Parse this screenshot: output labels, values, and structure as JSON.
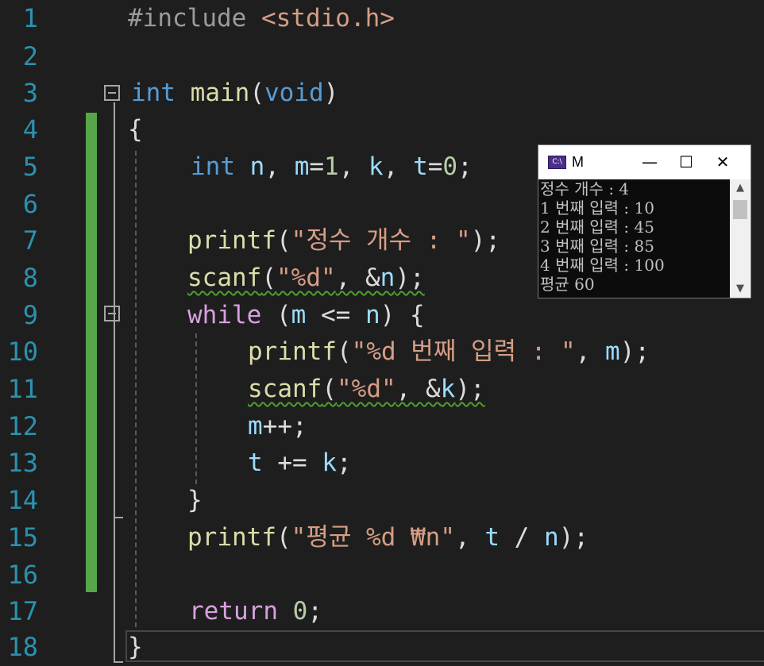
{
  "editor": {
    "line_numbers": [
      "1",
      "2",
      "3",
      "4",
      "5",
      "6",
      "7",
      "8",
      "9",
      "10",
      "11",
      "12",
      "13",
      "14",
      "15",
      "16",
      "17",
      "18"
    ],
    "lines": {
      "l1": {
        "pp": "#include",
        "header": "<stdio.h>"
      },
      "l3": {
        "kw_int": "int",
        "fn_main": "main",
        "paren_open": "(",
        "kw_void": "void",
        "paren_close": ")"
      },
      "l4": {
        "brace": "{"
      },
      "l5": {
        "kw_int": "int",
        "n": "n",
        "comma1": ",",
        "m": "m",
        "eq1": "=",
        "one": "1",
        "comma2": ",",
        "k": "k",
        "comma3": ",",
        "t": "t",
        "eq2": "=",
        "zero": "0",
        "semi": ";"
      },
      "l7": {
        "fn": "printf",
        "open": "(",
        "str": "\"정수 개수 : \"",
        "close": ");"
      },
      "l8": {
        "fn": "scanf",
        "open": "(",
        "str": "\"%d\"",
        "sep": ", &",
        "var": "n",
        "close": ");"
      },
      "l9": {
        "kw_while": "while",
        "open": " (",
        "m": "m",
        "op": " <= ",
        "n": "n",
        "close": ") {"
      },
      "l10": {
        "fn": "printf",
        "open": "(",
        "str": "\"%d 번째 입력 : \"",
        "sep": ", ",
        "var": "m",
        "close": ");"
      },
      "l11": {
        "fn": "scanf",
        "open": "(",
        "str": "\"%d\"",
        "sep": ", &",
        "var": "k",
        "close": ");"
      },
      "l12": {
        "var": "m",
        "op": "++;"
      },
      "l13": {
        "t": "t",
        "op": " += ",
        "k": "k",
        "semi": ";"
      },
      "l14": {
        "brace": "}"
      },
      "l15": {
        "fn": "printf",
        "open": "(",
        "str": "\"평균 %d ₩n\"",
        "sep": ", ",
        "t": "t",
        "op": " / ",
        "n": "n",
        "close": ");"
      },
      "l17": {
        "kw_return": "return",
        "zero": "0",
        "semi": ";"
      },
      "l18": {
        "brace": "}"
      }
    }
  },
  "console": {
    "icon_text": "C:\\",
    "title": "M",
    "minimize": "—",
    "maximize": "☐",
    "close": "✕",
    "scroll_up": "▲",
    "scroll_down": "▼",
    "output_lines": [
      "정수 개수 : 4",
      "1 번째 입력 : 10",
      "2 번째 입력 : 45",
      "3 번째 입력 : 85",
      "4 번째 입력 : 100",
      "평균 60"
    ]
  },
  "colors": {
    "background": "#1e1e1e",
    "line_number": "#2b91af",
    "keyword": "#569cd6",
    "control_keyword": "#d8a0df",
    "function": "#dcdcaa",
    "variable": "#9cdcfe",
    "string": "#d69d85",
    "number": "#b5cea8",
    "change_bar": "#57a64a",
    "squiggle": "#4aa02c"
  }
}
